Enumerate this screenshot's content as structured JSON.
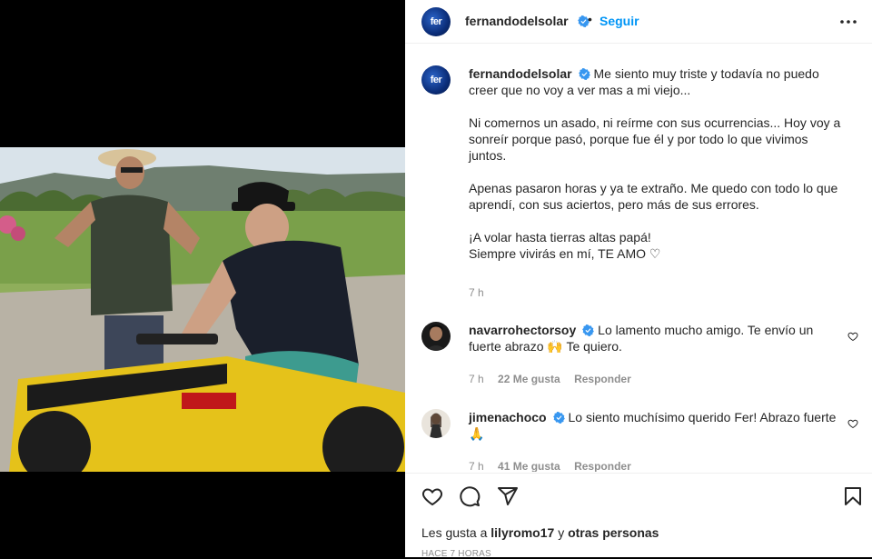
{
  "post": {
    "author": "fernandodelsolar",
    "avatar_text": "fer",
    "follow_label": "Seguir",
    "separator": "•"
  },
  "caption": {
    "username": "fernandodelsolar",
    "paragraphs": [
      "Me siento muy triste y todavía no puedo creer que no voy a ver mas a mi viejo...",
      "Ni comernos un asado, ni reírme con sus ocurrencias... Hoy voy a sonreír porque pasó, porque fue él y por todo lo que vivimos juntos.",
      "Apenas pasaron horas y ya te extraño. Me quedo con todo lo que aprendí, con sus aciertos, pero más de sus errores.",
      "¡A volar hasta tierras altas papá!",
      "Siempre vivirás en mí, TE AMO ♡"
    ],
    "time": "7 h"
  },
  "comments": [
    {
      "username": "navarrohectorsoy",
      "text": "Lo lamento mucho amigo. Te envío un fuerte abrazo 🙌  Te quiero.",
      "time": "7 h",
      "likes": "22 Me gusta",
      "reply": "Responder"
    },
    {
      "username": "jimenachoco",
      "text": "Lo siento muchísimo querido Fer! Abrazo fuerte 🙏",
      "time": "7 h",
      "likes": "41 Me gusta",
      "reply": "Responder"
    }
  ],
  "footer": {
    "likes_prefix": "Les gusta a",
    "likes_user": "lilyromo17",
    "likes_conj": "y",
    "likes_others": "otras personas",
    "date": "HACE 7 HORAS"
  },
  "icons": {
    "like": "heart-icon",
    "comment": "comment-icon",
    "share": "share-icon",
    "save": "bookmark-icon",
    "more": "more-options-icon",
    "verified": "verified-badge-icon"
  },
  "colors": {
    "accent": "#0095f6",
    "verified": "#3897f0",
    "muted": "#8e8e8e",
    "text": "#262626"
  }
}
